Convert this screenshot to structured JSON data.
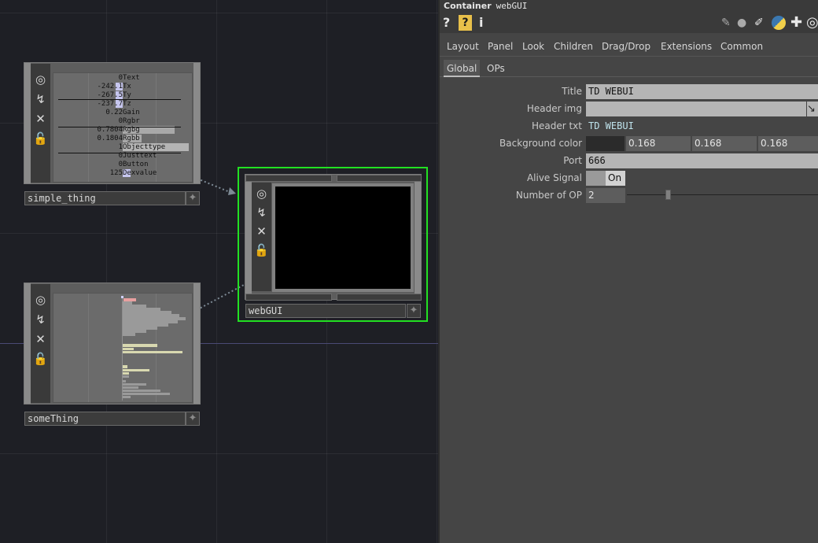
{
  "panel": {
    "op_type": "Container",
    "op_name": "webGUI",
    "toolbar": {
      "help": "?",
      "help_box": "?",
      "info": "i"
    },
    "pages": [
      "Layout",
      "Panel",
      "Look",
      "Children",
      "Drag/Drop",
      "Extensions",
      "Common"
    ],
    "subpages": [
      "Global",
      "OPs"
    ],
    "params": {
      "title": {
        "label": "Title",
        "value": "TD WEBUI"
      },
      "header_img": {
        "label": "Header img",
        "value": ""
      },
      "header_txt": {
        "label": "Header txt",
        "value": "TD WEBUI"
      },
      "background_color": {
        "label": "Background color",
        "r": "0.168",
        "g": "0.168",
        "b": "0.168"
      },
      "port": {
        "label": "Port",
        "value": "666"
      },
      "alive_signal": {
        "label": "Alive Signal",
        "value": "On"
      },
      "number_of_op": {
        "label": "Number of OP",
        "value": "2"
      }
    }
  },
  "network": {
    "nodes": {
      "simple_thing": {
        "name": "simple_thing",
        "rows": [
          {
            "value": "0",
            "name": "Text"
          },
          {
            "value": "-242.1",
            "name": "Tx"
          },
          {
            "value": "-267.5",
            "name": "Ty"
          },
          {
            "value": "-237.7",
            "name": "Tz"
          },
          {
            "value": "0.22",
            "name": "Gain"
          },
          {
            "value": "0",
            "name": "Rgbr"
          },
          {
            "value": "0.7804",
            "name": "Rgbg"
          },
          {
            "value": "0.1804",
            "name": "Rgbb"
          },
          {
            "value": "1",
            "name": "Objecttype"
          },
          {
            "value": "0",
            "name": "Justtext"
          },
          {
            "value": "0",
            "name": "Button"
          },
          {
            "value": "125",
            "name": "Dexvalue"
          }
        ]
      },
      "some_thing": {
        "name": "someThing"
      },
      "web_gui": {
        "name": "webGUI"
      }
    }
  },
  "colors": {
    "selected_border": "#22e022",
    "bar_highlight": "#d8d8b0",
    "bar_gray": "#9a9a9a",
    "value_highlight": "#c6c6ef"
  }
}
